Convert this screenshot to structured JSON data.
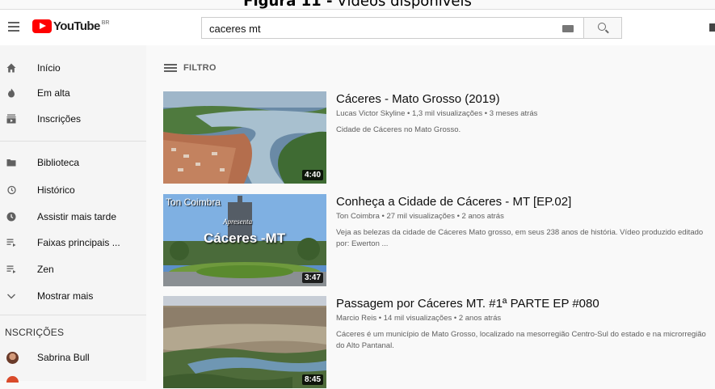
{
  "caption": {
    "bold": "Figura 11 -",
    "text": " Vídeos disponíveis"
  },
  "header": {
    "logo_text": "YouTube",
    "logo_region": "BR",
    "search_value": "caceres mt"
  },
  "sidebar": {
    "items": [
      {
        "label": "Início",
        "icon": "home-icon"
      },
      {
        "label": "Em alta",
        "icon": "flame-icon"
      },
      {
        "label": "Inscrições",
        "icon": "subscriptions-icon"
      },
      {
        "label": "Biblioteca",
        "icon": "folder-icon"
      },
      {
        "label": "Histórico",
        "icon": "history-icon"
      },
      {
        "label": "Assistir mais tarde",
        "icon": "clock-icon"
      },
      {
        "label": "Faixas principais ...",
        "icon": "playlist-icon"
      },
      {
        "label": "Zen",
        "icon": "playlist-icon"
      },
      {
        "label": "Mostrar mais",
        "icon": "chevron-down-icon"
      }
    ],
    "subscriptions_title": "NSCRIÇÕES",
    "subscriptions": [
      {
        "label": "Sabrina Bull"
      }
    ]
  },
  "main": {
    "filter_label": "FILTRO",
    "videos": [
      {
        "title": "Cáceres - Mato Grosso (2019)",
        "meta": "Lucas Victor Skyline • 1,3 mil visualizações • 3 meses atrás",
        "description": "Cidade de Cáceres no Mato Grosso.",
        "duration": "4:40"
      },
      {
        "title": "Conheça a Cidade de Cáceres - MT [EP.02]",
        "meta": "Ton Coimbra • 27 mil visualizações • 2 anos atrás",
        "description": "Veja as belezas da cidade de Cáceres Mato grosso, em seus 238 anos de história. Vídeo produzido editado por: Ewerton ...",
        "duration": "3:47",
        "thumb_text_1": "Ton Coimbra",
        "thumb_text_2": "Apresenta",
        "thumb_text_3": "Cáceres -MT"
      },
      {
        "title": "Passagem por Cáceres MT. #1ª PARTE EP #080",
        "meta": "Marcio Reis • 14 mil visualizações • 2 anos atrás",
        "description": "Cáceres é um município de Mato Grosso, localizado na mesorregião Centro-Sul do estado e na microrregião do Alto Pantanal.",
        "duration": "8:45"
      }
    ]
  }
}
